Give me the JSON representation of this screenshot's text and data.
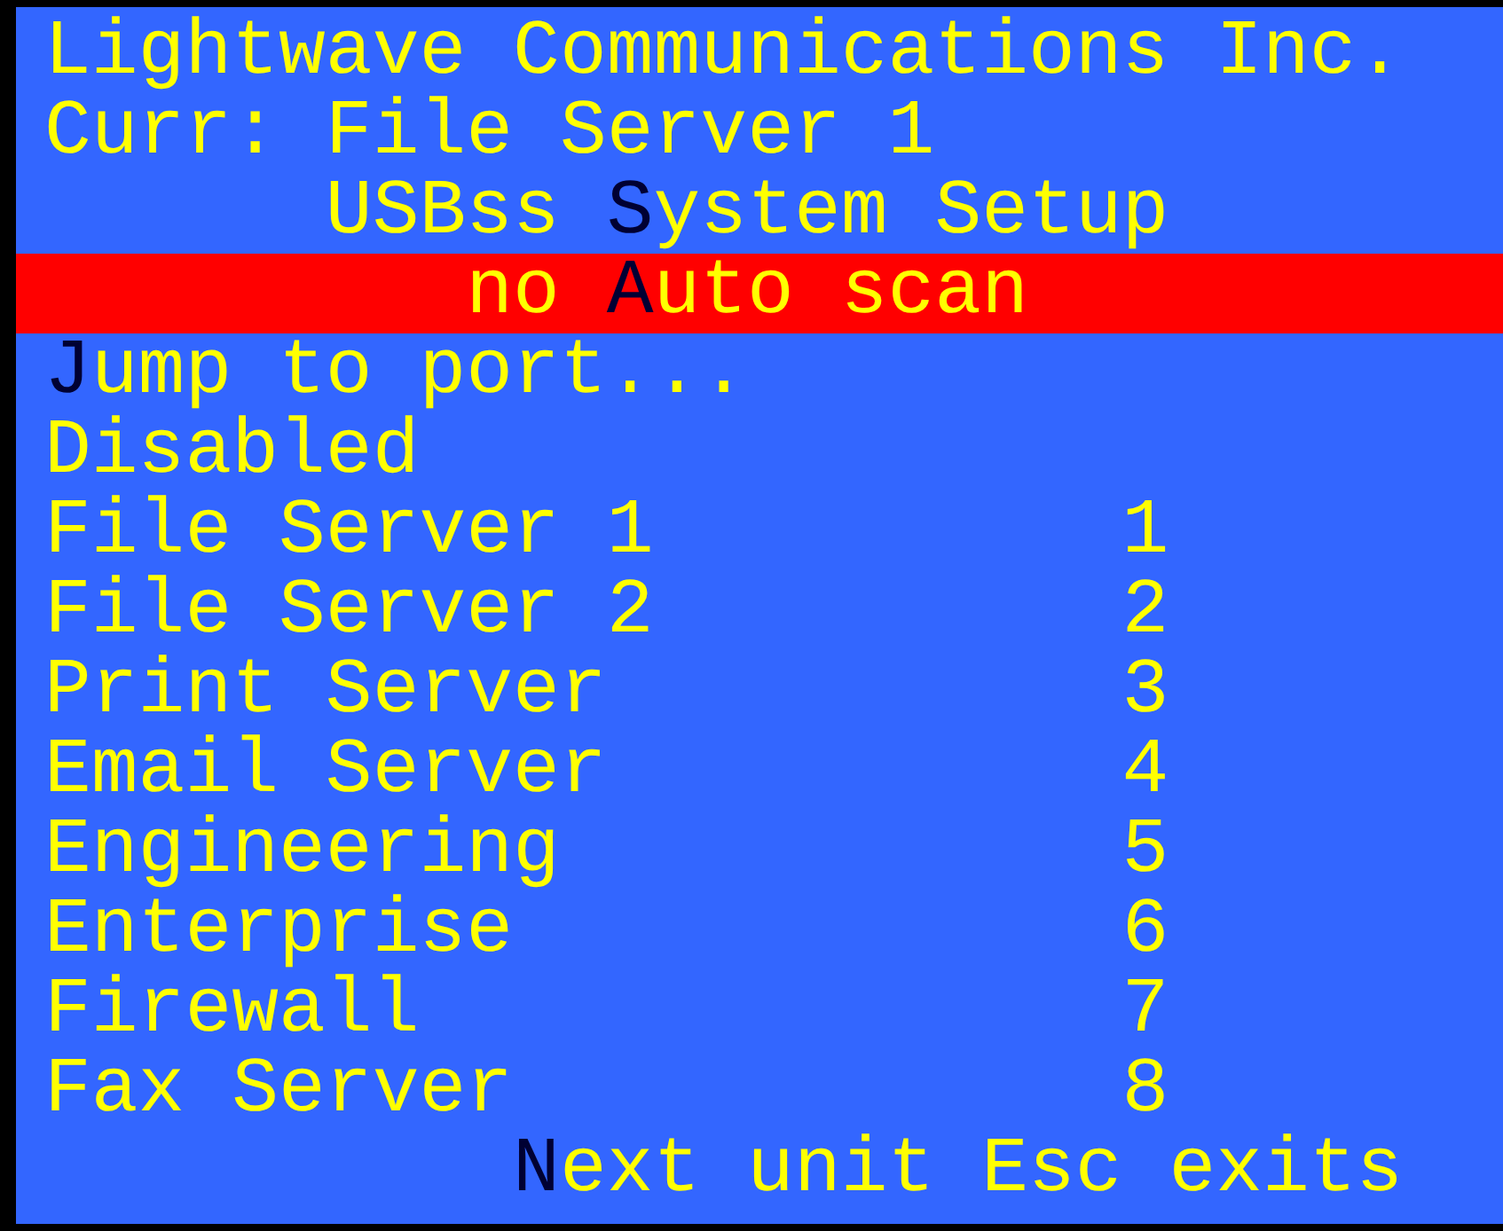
{
  "header": {
    "company": "Lightwave Communications Inc.",
    "current": "Curr: File Server 1",
    "menu_title": [
      {
        "text": "USBss ",
        "hotkey": false
      },
      {
        "text": "S",
        "hotkey": true
      },
      {
        "text": "ystem Setup",
        "hotkey": false
      }
    ]
  },
  "items": [
    {
      "kind": "option",
      "selected": true,
      "segments": [
        {
          "text": "no ",
          "hotkey": false
        },
        {
          "text": "A",
          "hotkey": true
        },
        {
          "text": "uto scan",
          "hotkey": false
        }
      ]
    },
    {
      "kind": "option",
      "selected": false,
      "segments": [
        {
          "text": "J",
          "hotkey": true
        },
        {
          "text": "ump to port...",
          "hotkey": false
        }
      ]
    },
    {
      "kind": "option",
      "selected": false,
      "segments": [
        {
          "text": "Disabled",
          "hotkey": false
        }
      ]
    },
    {
      "kind": "port",
      "selected": false,
      "name": "File Server 1",
      "number": "1"
    },
    {
      "kind": "port",
      "selected": false,
      "name": "File Server 2",
      "number": "2"
    },
    {
      "kind": "port",
      "selected": false,
      "name": "Print Server",
      "number": "3"
    },
    {
      "kind": "port",
      "selected": false,
      "name": "Email Server",
      "number": "4"
    },
    {
      "kind": "port",
      "selected": false,
      "name": "Engineering",
      "number": "5"
    },
    {
      "kind": "port",
      "selected": false,
      "name": "Enterprise",
      "number": "6"
    },
    {
      "kind": "port",
      "selected": false,
      "name": "Firewall",
      "number": "7"
    },
    {
      "kind": "port",
      "selected": false,
      "name": "Fax Server",
      "number": "8"
    }
  ],
  "footer": [
    {
      "text": "N",
      "hotkey": true
    },
    {
      "text": "ext unit Esc exits",
      "hotkey": false
    }
  ]
}
